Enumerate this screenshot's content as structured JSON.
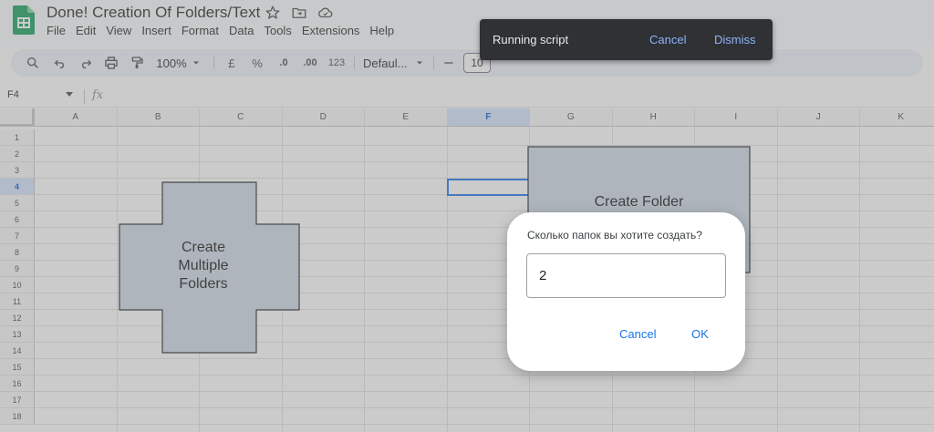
{
  "document": {
    "title": "Done! Creation Of Folders/Text"
  },
  "menu": [
    "File",
    "Edit",
    "View",
    "Insert",
    "Format",
    "Data",
    "Tools",
    "Extensions",
    "Help"
  ],
  "toolbar": {
    "zoom": "100%",
    "currency": "£",
    "percent": "%",
    "decimal_decrease": ".0",
    "decimal_increase": ".00",
    "number_format": "123",
    "font": "Defaul...",
    "font_size": "10"
  },
  "formula_bar": {
    "cell_ref": "F4",
    "fx": "fx"
  },
  "grid": {
    "columns": [
      "A",
      "B",
      "C",
      "D",
      "E",
      "F",
      "G",
      "H",
      "I",
      "J",
      "K"
    ],
    "rows": [
      "1",
      "2",
      "3",
      "4",
      "5",
      "6",
      "7",
      "8",
      "9",
      "10",
      "11",
      "12",
      "13",
      "14",
      "15",
      "16",
      "17",
      "18"
    ],
    "active_column": "F",
    "active_row": "4"
  },
  "drawings": {
    "cross_lines": [
      "Create",
      "Multiple",
      "Folders"
    ],
    "rect_text": "Create Folder",
    "fill_color": "#cdd9e6"
  },
  "snackbar": {
    "text": "Running script",
    "cancel": "Cancel",
    "dismiss": "Dismiss"
  },
  "dialog": {
    "prompt": "Сколько папок вы хотите создать?",
    "value": "2",
    "cancel": "Cancel",
    "ok": "OK"
  },
  "colors": {
    "accent": "#1a73e8",
    "sheets_green": "#0f9d58"
  }
}
